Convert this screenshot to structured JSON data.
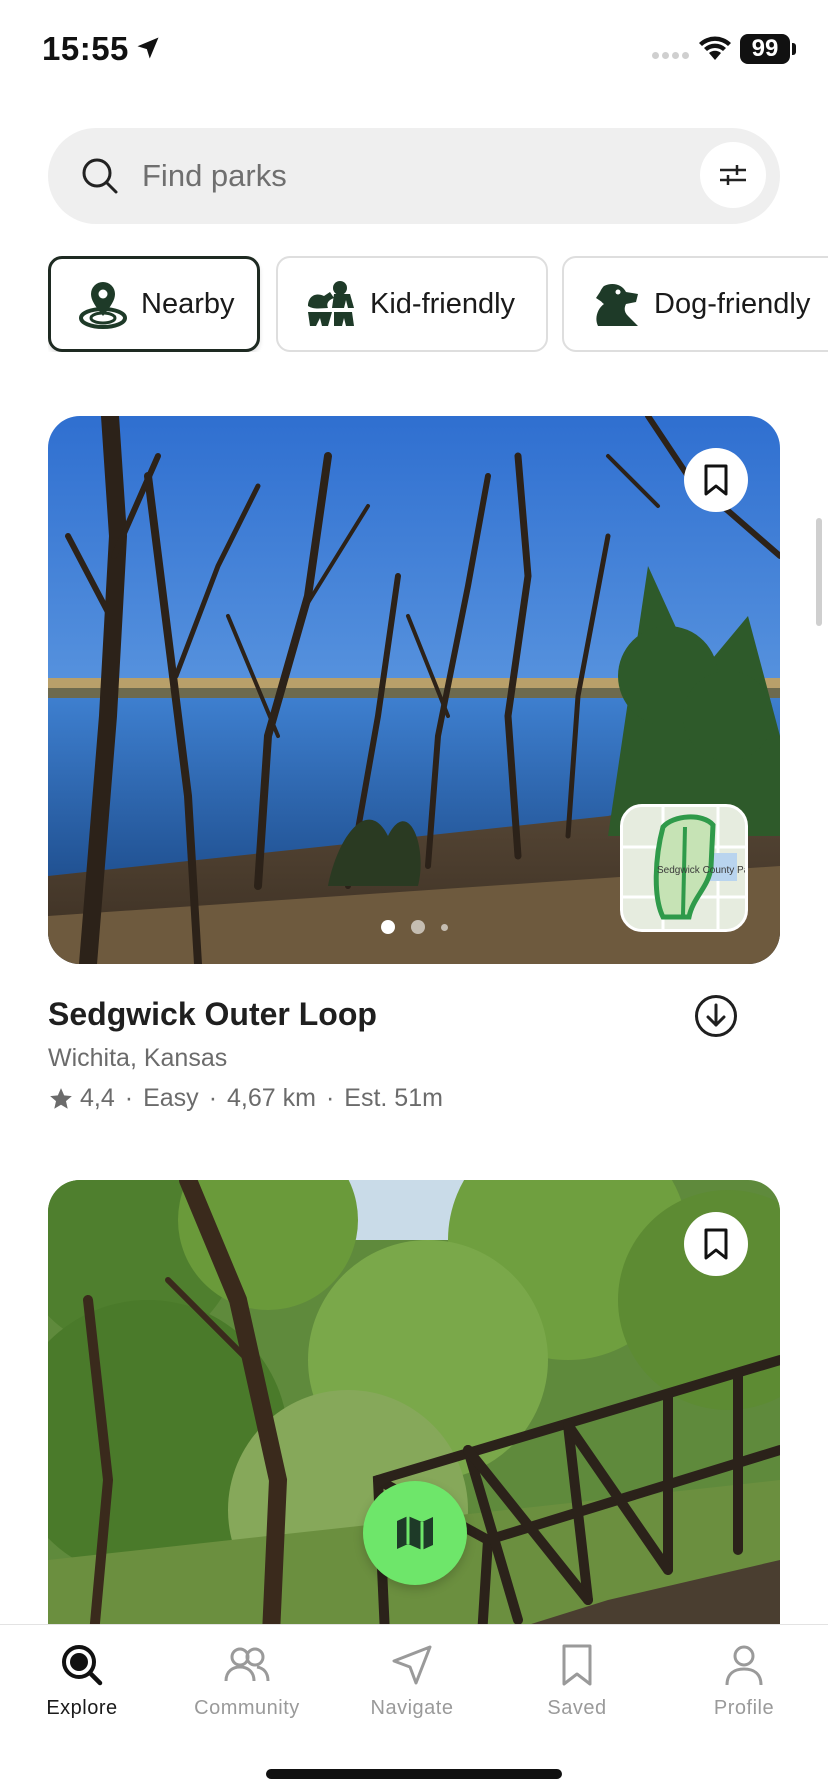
{
  "status_bar": {
    "time": "15:55",
    "battery": "99"
  },
  "search": {
    "placeholder": "Find parks"
  },
  "chips": [
    {
      "label": "Nearby",
      "icon": "location-pin-icon",
      "active": true
    },
    {
      "label": "Kid-friendly",
      "icon": "kid-friendly-icon",
      "active": false
    },
    {
      "label": "Dog-friendly",
      "icon": "dog-icon",
      "active": false
    }
  ],
  "trails": [
    {
      "name": "Sedgwick Outer Loop",
      "location": "Wichita, Kansas",
      "rating": "4,4",
      "difficulty": "Easy",
      "distance": "4,67 km",
      "duration": "Est. 51m",
      "map_label": "Sedgwick County Park"
    }
  ],
  "tabs": [
    {
      "label": "Explore",
      "icon": "explore-search-icon",
      "active": true
    },
    {
      "label": "Community",
      "icon": "community-icon",
      "active": false
    },
    {
      "label": "Navigate",
      "icon": "navigate-icon",
      "active": false
    },
    {
      "label": "Saved",
      "icon": "bookmark-icon",
      "active": false
    },
    {
      "label": "Profile",
      "icon": "profile-icon",
      "active": false
    }
  ],
  "colors": {
    "accent_green": "#6ee66a",
    "dark_green": "#1e3a28",
    "text": "#1f1f1f",
    "muted": "#6b6b6b"
  }
}
